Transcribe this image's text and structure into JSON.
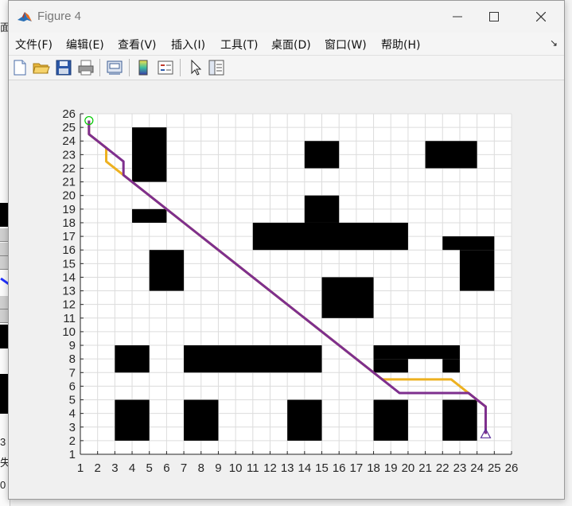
{
  "window": {
    "title": "Figure 4",
    "minimize_glyph": "—",
    "maximize_glyph": "☐",
    "close_glyph": "✕"
  },
  "menu": [
    "文件(F)",
    "编辑(E)",
    "查看(V)",
    "插入(I)",
    "工具(T)",
    "桌面(D)",
    "窗口(W)",
    "帮助(H)"
  ],
  "menu_overflow_glyph": "↘",
  "toolbar": [
    "new-file-icon",
    "open-folder-icon",
    "save-icon",
    "print-icon",
    "print-preview-icon",
    "colorbar-icon",
    "legend-icon",
    "edit-plot-arrow-icon",
    "property-inspector-icon"
  ],
  "background_window": {
    "fragments": [
      "面",
      "3",
      "失",
      "0"
    ]
  },
  "chart_data": {
    "type": "line",
    "title": "",
    "xlabel": "",
    "ylabel": "",
    "xlim": [
      1,
      26
    ],
    "ylim": [
      1,
      26
    ],
    "xticks": [
      1,
      2,
      3,
      4,
      5,
      6,
      7,
      8,
      9,
      10,
      11,
      12,
      13,
      14,
      15,
      16,
      17,
      18,
      19,
      20,
      21,
      22,
      23,
      24,
      25,
      26
    ],
    "yticks": [
      1,
      2,
      3,
      4,
      5,
      6,
      7,
      8,
      9,
      10,
      11,
      12,
      13,
      14,
      15,
      16,
      17,
      18,
      19,
      20,
      21,
      22,
      23,
      24,
      25,
      26
    ],
    "grid": true,
    "obstacles": [
      {
        "x": [
          4,
          6
        ],
        "y": [
          21,
          25
        ]
      },
      {
        "x": [
          4,
          6
        ],
        "y": [
          18,
          19
        ]
      },
      {
        "x": [
          5,
          7
        ],
        "y": [
          13,
          16
        ]
      },
      {
        "x": [
          3,
          5
        ],
        "y": [
          7,
          9
        ]
      },
      {
        "x": [
          3,
          5
        ],
        "y": [
          2,
          5
        ]
      },
      {
        "x": [
          7,
          15
        ],
        "y": [
          7,
          9
        ]
      },
      {
        "x": [
          7,
          9
        ],
        "y": [
          2,
          5
        ]
      },
      {
        "x": [
          13,
          15
        ],
        "y": [
          2,
          5
        ]
      },
      {
        "x": [
          14,
          16
        ],
        "y": [
          22,
          24
        ]
      },
      {
        "x": [
          14,
          16
        ],
        "y": [
          18,
          20
        ]
      },
      {
        "x": [
          11,
          20
        ],
        "y": [
          16,
          18
        ]
      },
      {
        "x": [
          15,
          18
        ],
        "y": [
          11,
          14
        ]
      },
      {
        "x": [
          18,
          23
        ],
        "y": [
          8,
          9
        ]
      },
      {
        "x": [
          18,
          20
        ],
        "y": [
          7,
          8
        ]
      },
      {
        "x": [
          22,
          23
        ],
        "y": [
          7,
          8
        ]
      },
      {
        "x": [
          18,
          20
        ],
        "y": [
          2,
          5
        ]
      },
      {
        "x": [
          22,
          24
        ],
        "y": [
          2,
          5
        ]
      },
      {
        "x": [
          21,
          24
        ],
        "y": [
          22,
          24
        ]
      },
      {
        "x": [
          22,
          25
        ],
        "y": [
          16,
          17
        ]
      },
      {
        "x": [
          23,
          25
        ],
        "y": [
          13,
          16
        ]
      }
    ],
    "series": [
      {
        "color": "#EDB120",
        "x": [
          1.5,
          1.5,
          2.5,
          2.5,
          3.5,
          18.5,
          22.5,
          23.5,
          24.5,
          24.5
        ],
        "y": [
          25.5,
          24.5,
          23.5,
          22.5,
          21.5,
          6.5,
          6.5,
          5.5,
          4.5,
          2.5
        ]
      },
      {
        "color": "#7E2F8E",
        "x": [
          1.5,
          1.5,
          3.5,
          3.5,
          18.5,
          19.5,
          23.5,
          24.5,
          24.5
        ],
        "y": [
          25.5,
          24.5,
          22.5,
          21.5,
          6.5,
          5.5,
          5.5,
          4.5,
          2.5
        ]
      }
    ],
    "start_marker": {
      "x": 1.5,
      "y": 25.5,
      "shape": "circle",
      "color": "#00c800"
    },
    "goal_marker": {
      "x": 24.5,
      "y": 2.5,
      "shape": "triangle",
      "color": "#5a2d9a"
    }
  }
}
